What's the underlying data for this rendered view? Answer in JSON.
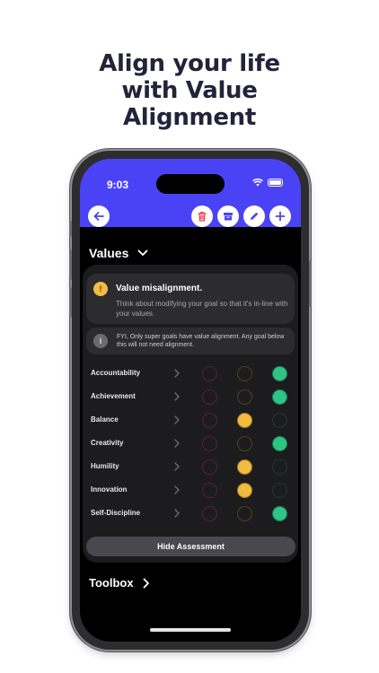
{
  "headline": [
    "Align your life",
    "with Value",
    "Alignment"
  ],
  "status_bar": {
    "time": "9:03"
  },
  "colors": {
    "accent": "#4a43f5",
    "danger": "#e8424f",
    "warning": "#f0bb40",
    "success": "#2fc486"
  },
  "toolbar": {
    "back": "arrow-left-icon",
    "actions": [
      "trash-icon",
      "archive-icon",
      "pencil-icon",
      "plus-icon"
    ]
  },
  "values_section": {
    "title": "Values"
  },
  "alert": {
    "icon_text": "!",
    "title": "Value misalignment.",
    "text": "Think about modifying your goal so that it's in-line with your values."
  },
  "fyi": {
    "icon_text": "i",
    "text": "FYI, Only super goals have value alignment. Any goal below this will not need alignment."
  },
  "values": [
    {
      "name": "Accountability",
      "rating": "green"
    },
    {
      "name": "Achievement",
      "rating": "green"
    },
    {
      "name": "Balance",
      "rating": "yellow"
    },
    {
      "name": "Creativity",
      "rating": "green"
    },
    {
      "name": "Humility",
      "rating": "yellow"
    },
    {
      "name": "Innovation",
      "rating": "yellow"
    },
    {
      "name": "Self-Discipline",
      "rating": "green"
    }
  ],
  "hide_button": "Hide Assessment",
  "toolbox": {
    "title": "Toolbox"
  }
}
